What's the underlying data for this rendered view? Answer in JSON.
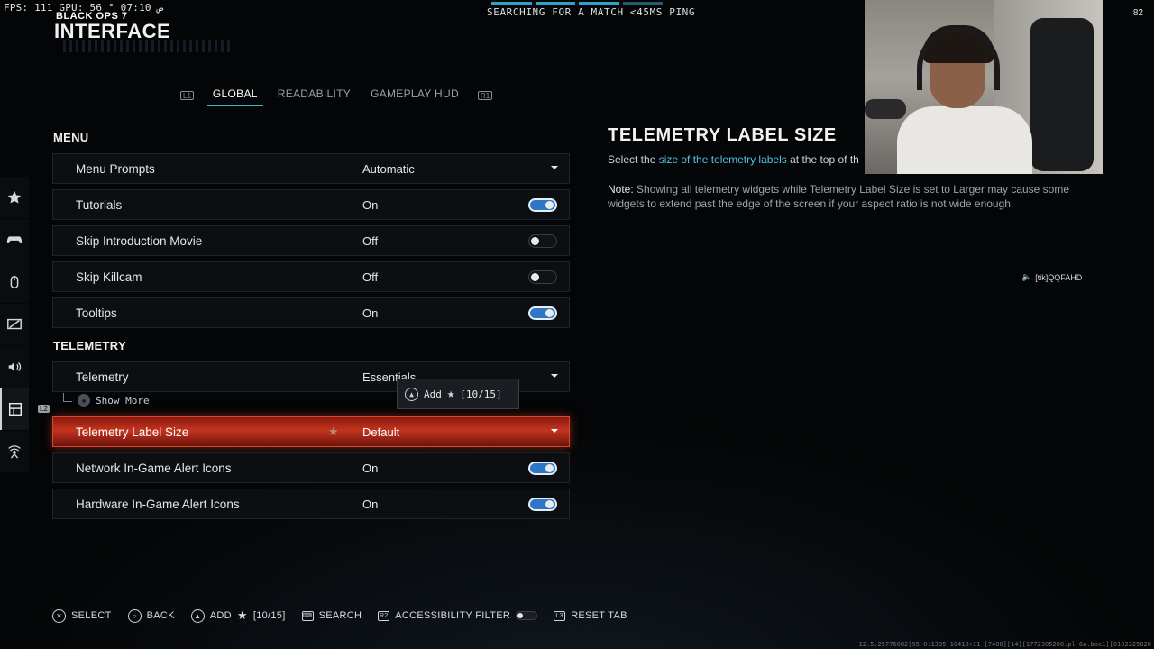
{
  "hud": {
    "stats": "FPS: 111  GPU: 56 °  07:10 ص",
    "corner_counter": "82",
    "matchmaking": "SEARCHING FOR A MATCH <45MS PING",
    "build_info": "12.5.25776082[95-0:1335]10418+11 [7400][14][1772305208.pl 6a.boe1][0102225820",
    "sound_tag": "[tik]QQFAHD"
  },
  "header": {
    "game_logo": "BLACK OPS 7",
    "title": "INTERFACE"
  },
  "tabs": {
    "left_bumper": "L1",
    "right_bumper": "R1",
    "items": [
      {
        "label": "GLOBAL",
        "active": true
      },
      {
        "label": "READABILITY",
        "active": false
      },
      {
        "label": "GAMEPLAY HUD",
        "active": false
      }
    ]
  },
  "menu": {
    "section_title": "MENU",
    "rows": [
      {
        "label": "Menu Prompts",
        "value": "Automatic",
        "control": "dropdown"
      },
      {
        "label": "Tutorials",
        "value": "On",
        "control": "toggle-on"
      },
      {
        "label": "Skip Introduction Movie",
        "value": "Off",
        "control": "toggle-off"
      },
      {
        "label": "Skip Killcam",
        "value": "Off",
        "control": "toggle-off"
      },
      {
        "label": "Tooltips",
        "value": "On",
        "control": "toggle-on"
      }
    ]
  },
  "telemetry": {
    "section_title": "TELEMETRY",
    "telemetry_row": {
      "label": "Telemetry",
      "value": "Essentials"
    },
    "show_more": "Show More",
    "label_size_row": {
      "label": "Telemetry Label Size",
      "value": "Default"
    },
    "network_row": {
      "label": "Network In-Game Alert Icons",
      "value": "On"
    },
    "hardware_row": {
      "label": "Hardware In-Game Alert Icons",
      "value": "On"
    }
  },
  "tooltip": {
    "add_label": "Add",
    "count": "[10/15]"
  },
  "rail": {
    "l2_badge": "L2",
    "icons": [
      "star-icon",
      "controller-icon",
      "mouse-icon",
      "display-icon",
      "speaker-icon",
      "interface-icon",
      "network-icon"
    ]
  },
  "description": {
    "title": "TELEMETRY LABEL SIZE",
    "body_prefix": "Select the ",
    "body_highlight": "size of the telemetry labels",
    "body_suffix": " at the top of th",
    "note_label": "Note:",
    "note_text": " Showing all telemetry widgets while Telemetry Label Size is set to Larger may cause some widgets to extend past the edge of the screen if your aspect ratio is not wide enough."
  },
  "footer": {
    "select": "SELECT",
    "back": "BACK",
    "add": "ADD",
    "add_count": "[10/15]",
    "search": "SEARCH",
    "accessibility_filter": "ACCESSIBILITY FILTER",
    "reset_tab": "RESET TAB",
    "l3_label": "L3",
    "r2_label": "R2"
  },
  "colors": {
    "accent": "#3fb4d6",
    "active_row": "#c4341f",
    "toggle_on": "#2f76c6"
  }
}
